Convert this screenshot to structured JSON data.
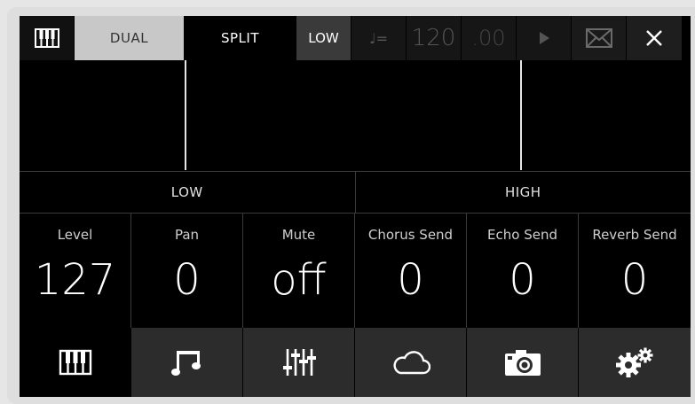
{
  "topbar": {
    "keyboard_icon": "keyboard-icon",
    "dual_label": "DUAL",
    "split_label": "SPLIT",
    "low_label": "LOW",
    "tempo_note_label": "♩=",
    "tempo_value": "120",
    "tempo_fraction": ".00",
    "play_icon": "play-icon",
    "mail_icon": "mail-icon",
    "close_icon": "close-icon"
  },
  "zones": {
    "low": "LOW",
    "high": "HIGH"
  },
  "params": [
    {
      "label": "Level",
      "value": "127"
    },
    {
      "label": "Pan",
      "value": "0"
    },
    {
      "label": "Mute",
      "value": "off"
    },
    {
      "label": "Chorus Send",
      "value": "0"
    },
    {
      "label": "Echo Send",
      "value": "0"
    },
    {
      "label": "Reverb Send",
      "value": "0"
    }
  ],
  "nav": [
    {
      "icon": "keyboard-icon",
      "active": true
    },
    {
      "icon": "music-note-icon",
      "active": false
    },
    {
      "icon": "mixer-sliders-icon",
      "active": false
    },
    {
      "icon": "cloud-icon",
      "active": false
    },
    {
      "icon": "camera-icon",
      "active": false
    },
    {
      "icon": "gears-icon",
      "active": false
    }
  ],
  "colors": {
    "screen_bg": "#000000",
    "active_tab_bg": "#c8c8c8",
    "nav_bg": "#2c2c2c",
    "split_line": "#e6e6e6"
  }
}
